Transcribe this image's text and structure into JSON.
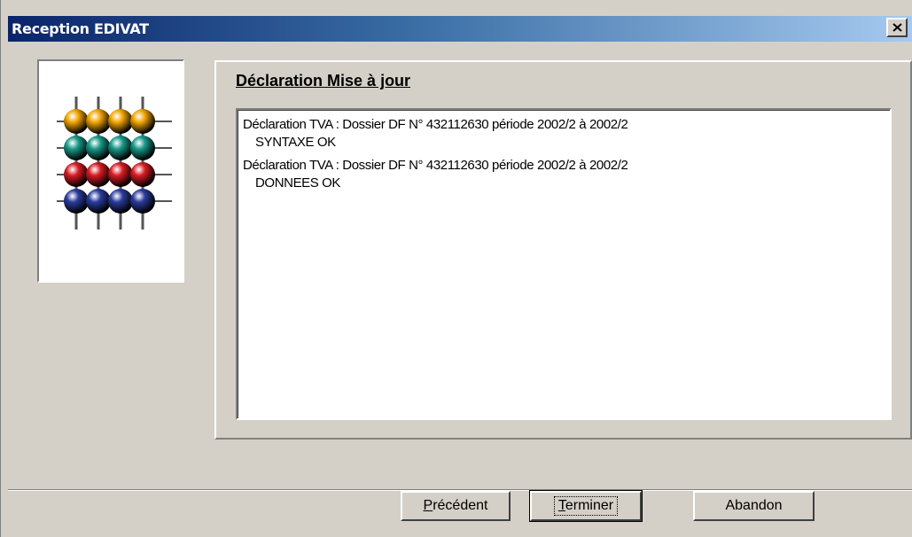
{
  "window": {
    "title": "Reception EDIVAT"
  },
  "header": {
    "title": "Déclaration Mise à jour"
  },
  "log": {
    "lines": [
      "Déclaration TVA : Dossier DF N° 432112630 période 2002/2 à 2002/2",
      "SYNTAXE OK",
      "Déclaration TVA : Dossier DF N° 432112630 période 2002/2 à 2002/2",
      "DONNEES OK"
    ]
  },
  "buttons": {
    "previous": {
      "mnemonic": "P",
      "rest": "récédent"
    },
    "finish": {
      "mnemonic": "T",
      "rest": "erminer"
    },
    "cancel": {
      "label": "Abandon"
    }
  },
  "colors": {
    "titlebar_start": "#0a246a",
    "titlebar_end": "#a6caf0",
    "face": "#d4d0c8",
    "ball_rows": [
      "#f2a500",
      "#1a9a8a",
      "#d81c24",
      "#2a3c9c"
    ]
  },
  "icons": {
    "close": "close-icon",
    "logo": "abacus-logo-icon"
  }
}
